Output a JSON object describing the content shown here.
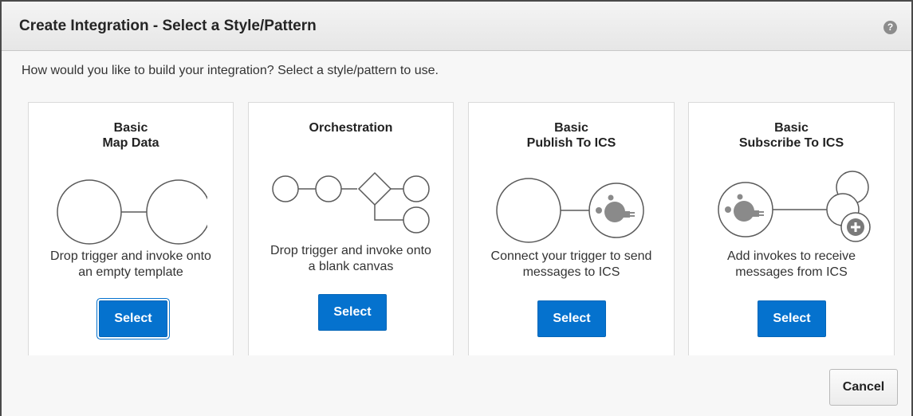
{
  "dialog": {
    "title": "Create Integration - Select a Style/Pattern",
    "help_icon": "question-circle-icon",
    "help_glyph": "?",
    "prompt": "How would you like to build your integration? Select a style/pattern to use.",
    "cancel_label": "Cancel"
  },
  "patterns": [
    {
      "title_line1": "Basic",
      "title_line2": "Map Data",
      "desc_line1": "Drop trigger and invoke onto",
      "desc_line2": "an empty template",
      "select_label": "Select",
      "diagram_icon": "map-data-diagram-icon"
    },
    {
      "title_line1": "Orchestration",
      "title_line2": "",
      "desc_line1": "Drop trigger and invoke onto",
      "desc_line2": "a blank canvas",
      "select_label": "Select",
      "diagram_icon": "orchestration-diagram-icon"
    },
    {
      "title_line1": "Basic",
      "title_line2": "Publish To ICS",
      "desc_line1": "Connect your trigger to send",
      "desc_line2": "messages to ICS",
      "select_label": "Select",
      "diagram_icon": "publish-to-ics-diagram-icon"
    },
    {
      "title_line1": "Basic",
      "title_line2": "Subscribe To ICS",
      "desc_line1": "Add invokes to receive",
      "desc_line2": "messages from ICS",
      "select_label": "Select",
      "diagram_icon": "subscribe-to-ics-diagram-icon"
    }
  ],
  "colors": {
    "primary_button": "#0572ce",
    "diagram_stroke": "#5a5a5a",
    "ics_icon_fill": "#8a8a8a"
  }
}
